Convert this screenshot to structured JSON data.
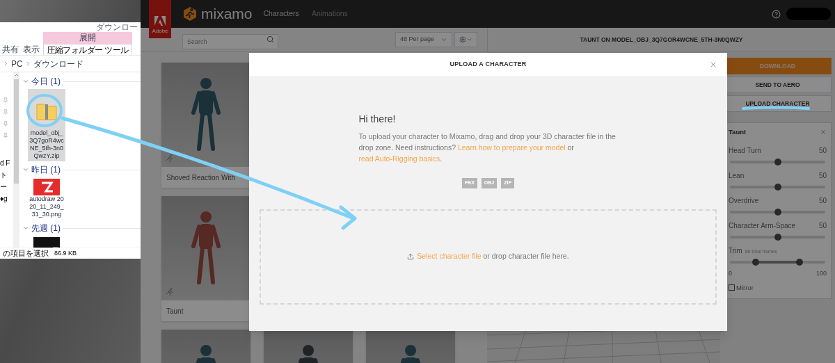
{
  "explorer": {
    "window_title": "ダウンロー",
    "ribbon_tabs": [
      {
        "label": "共有",
        "selected": false
      },
      {
        "label": "表示",
        "selected": false
      }
    ],
    "context_tab": {
      "group": "展開",
      "label": "圧縮フォルダー ツール",
      "selected": true
    },
    "breadcrumb": [
      "PC",
      "ダウンロード"
    ],
    "nav_items": [
      "d F",
      "ト",
      "ー",
      "♦g"
    ],
    "groups": [
      {
        "title": "今日 (1)",
        "expanded": true,
        "files": [
          {
            "name": "model_obj_3Q7goR4wcNE_5th-3n0QwzY.zip",
            "kind": "zip",
            "selected": true
          }
        ]
      },
      {
        "title": "昨日 (1)",
        "expanded": true,
        "files": [
          {
            "name": "autodraw 2020_11_249_31_30.png",
            "kind": "image",
            "selected": false
          }
        ]
      },
      {
        "title": "先週 (1)",
        "expanded": true,
        "files": [
          {
            "kind": "video",
            "selected": false
          }
        ]
      }
    ],
    "status": {
      "selection": "の項目を選択",
      "size": "86.9 KB"
    }
  },
  "app": {
    "badge": "Adobe",
    "logo": "mixamo",
    "nav": [
      {
        "label": "Characters",
        "selected": true
      },
      {
        "label": "Animations",
        "selected": false
      }
    ]
  },
  "toolbar": {
    "search_placeholder": "Search",
    "per_page": "48 Per page",
    "preview_title": "TAUNT ON MODEL_OBJ_3Q7GOR4WCNE_5TH-3N0QWZY"
  },
  "cards": [
    {
      "label": "Shoved Reaction With",
      "color": "#1a3139"
    },
    {
      "label": "Taunt",
      "color": "#562924"
    }
  ],
  "bottom_cards": [
    {
      "color": "#1a3139"
    },
    {
      "color": "#202325"
    },
    {
      "color": "#1a3139"
    }
  ],
  "actions": [
    {
      "label": "DOWNLOAD",
      "kind": "primary"
    },
    {
      "label": "SEND TO AERO",
      "kind": "secondary"
    },
    {
      "label": "UPLOAD CHARACTER",
      "kind": "secondary"
    }
  ],
  "settings": {
    "title": "Taunt",
    "sliders": [
      {
        "label": "Head Turn",
        "reading": "50",
        "level": 0.5
      },
      {
        "label": "Lean",
        "reading": "50",
        "level": 0.5
      },
      {
        "label": "Overdrive",
        "reading": "50",
        "level": 0.5
      },
      {
        "label": "Character Arm-Space",
        "reading": "50",
        "level": 0.5
      }
    ],
    "trim": {
      "label": "Trim",
      "note": "86 total frames",
      "start": {
        "level": 0.27
      },
      "end": {
        "level": 0.73
      },
      "min": "0",
      "max": "100"
    },
    "mirror": {
      "label": "Mirror",
      "checked": false
    }
  },
  "modal": {
    "title": "UPLOAD A CHARACTER",
    "heading": "Hi there!",
    "intro": {
      "text": "To upload your character to Mixamo, drag and drop your 3D character file in the drop zone. Need instructions?",
      "link_1": "Learn how to prepare your model",
      "joiner": "or",
      "link_2": "read Auto-Rigging basics",
      "end": "."
    },
    "formats": [
      "FBX",
      "OBJ",
      "ZIP"
    ],
    "drop_zone": {
      "link": "Select character file",
      "text": "or drop character file here."
    }
  }
}
